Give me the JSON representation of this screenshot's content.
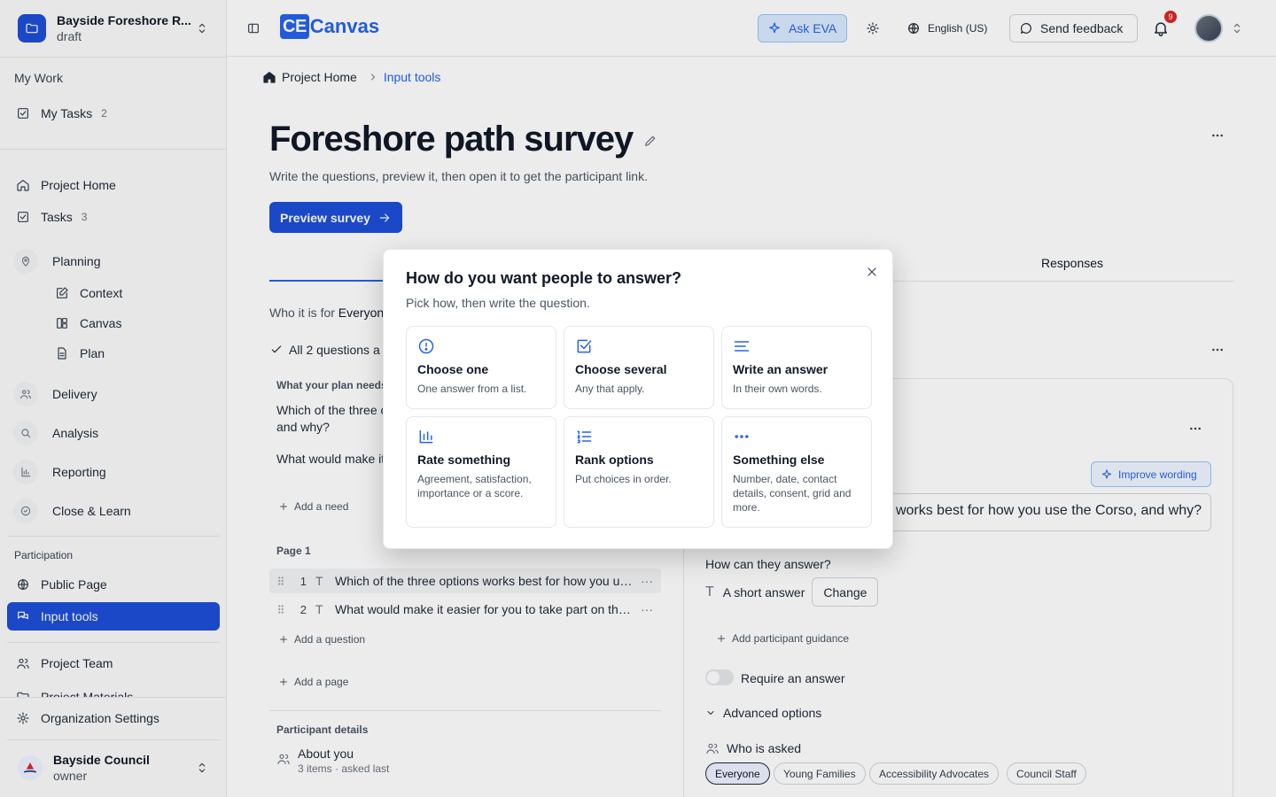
{
  "project": {
    "name": "Bayside Foreshore R...",
    "status": "draft"
  },
  "sidebar": {
    "my_work_heading": "My Work",
    "my_tasks": {
      "label": "My Tasks",
      "count": "2"
    },
    "items": [
      {
        "label": "Project Home"
      },
      {
        "label": "Tasks",
        "count": "3"
      },
      {
        "label": "Planning"
      },
      {
        "label": "Context"
      },
      {
        "label": "Canvas"
      },
      {
        "label": "Plan"
      },
      {
        "label": "Delivery"
      },
      {
        "label": "Analysis"
      },
      {
        "label": "Reporting"
      },
      {
        "label": "Close & Learn"
      }
    ],
    "participation_heading": "Participation",
    "participation_items": [
      {
        "label": "Public Page"
      },
      {
        "label": "Input tools"
      }
    ],
    "more_items": [
      {
        "label": "Project Team"
      },
      {
        "label": "Project Materials"
      }
    ],
    "org_settings": "Organization Settings",
    "org": {
      "name": "Bayside Council",
      "role": "owner"
    }
  },
  "topbar": {
    "logo_box": "CE",
    "logo_text": "Canvas",
    "ask_eva": "Ask EVA",
    "language": "English (US)",
    "feedback": "Send feedback",
    "notifications": "9"
  },
  "breadcrumb": {
    "home": "Project Home",
    "current": "Input tools"
  },
  "page": {
    "title": "Foreshore path survey",
    "subtitle": "Write the questions, preview it, then open it to get the participant link.",
    "preview_button": "Preview survey",
    "tab_responses": "Responses",
    "who_prefix": "Who it is for ",
    "who_value": "Everyone",
    "all_questions": "All 2 questions a",
    "needs_heading": "What your plan needs",
    "needs": [
      "Which of the three options works best for how you use the Corso, and why?",
      "What would make it easier for you to take part on the weekend?"
    ],
    "add_need": "Add a need",
    "page_label": "Page 1",
    "questions": [
      {
        "num": "1",
        "type": "T",
        "text": "Which of the three options works best for how you use the Corso, and why?"
      },
      {
        "num": "2",
        "type": "T",
        "text": "What would make it easier for you to take part on the weekend?"
      }
    ],
    "add_question": "Add a question",
    "add_page": "Add a page",
    "participant_details": "Participant details",
    "about_title": "About you",
    "about_meta": "3 items · asked last"
  },
  "editor": {
    "improve": "Improve wording",
    "question_value": "Which of the three options works best for how you use the Corso, and why?",
    "how_answer": "How can they answer?",
    "answer_type_glyph": "T",
    "answer_type": "A short answer",
    "change": "Change",
    "add_guidance": "Add participant guidance",
    "require": "Require an answer",
    "advanced": "Advanced options",
    "who_asked": "Who is asked",
    "chips": [
      "Everyone",
      "Young Families",
      "Accessibility Advocates",
      "Council Staff"
    ]
  },
  "modal": {
    "title": "How do you want people to answer?",
    "subtitle": "Pick how, then write the question.",
    "options": [
      {
        "title": "Choose one",
        "desc": "One answer from a list.",
        "icon": "radio-circle-icon"
      },
      {
        "title": "Choose several",
        "desc": "Any that apply.",
        "icon": "checkbox-icon"
      },
      {
        "title": "Write an answer",
        "desc": "In their own words.",
        "icon": "text-lines-icon"
      },
      {
        "title": "Rate something",
        "desc": "Agreement, satisfaction, importance or a score.",
        "icon": "bar-chart-icon"
      },
      {
        "title": "Rank options",
        "desc": "Put choices in order.",
        "icon": "numbered-list-icon"
      },
      {
        "title": "Something else",
        "desc": "Number, date, contact details, consent, grid and more.",
        "icon": "ellipsis-icon"
      }
    ]
  },
  "colors": {
    "accent": "#1d4ed8",
    "badge": "#dc2626"
  }
}
